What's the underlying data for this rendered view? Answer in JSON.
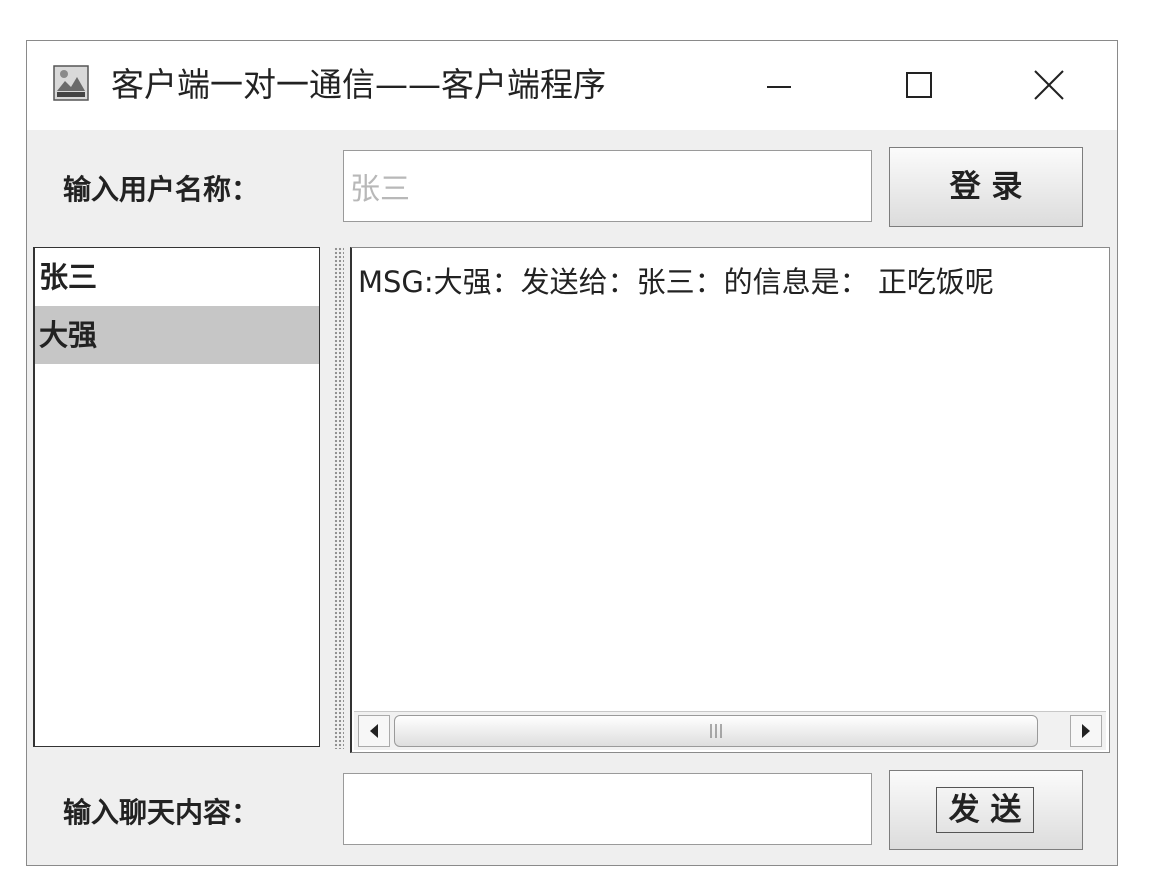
{
  "window": {
    "title": "客户端一对一通信——客户端程序",
    "controls": {
      "minimize": "minimize-icon",
      "maximize": "maximize-icon",
      "close": "close-icon"
    }
  },
  "login": {
    "label": "输入用户名称：",
    "username_value": "张三",
    "button_label": "登 录"
  },
  "users": {
    "items": [
      {
        "label": "张三",
        "selected": false
      },
      {
        "label": "大强",
        "selected": true
      }
    ]
  },
  "messages": {
    "lines": [
      "MSG:大强：发送给：张三：的信息是：  正吃饭呢"
    ]
  },
  "chat": {
    "label": "输入聊天内容：",
    "input_value": "",
    "button_label": "发 送"
  },
  "colors": {
    "window_bg": "#efefef",
    "selected_item_bg": "#c6c6c6",
    "placeholder_text": "#b8b8b8"
  }
}
